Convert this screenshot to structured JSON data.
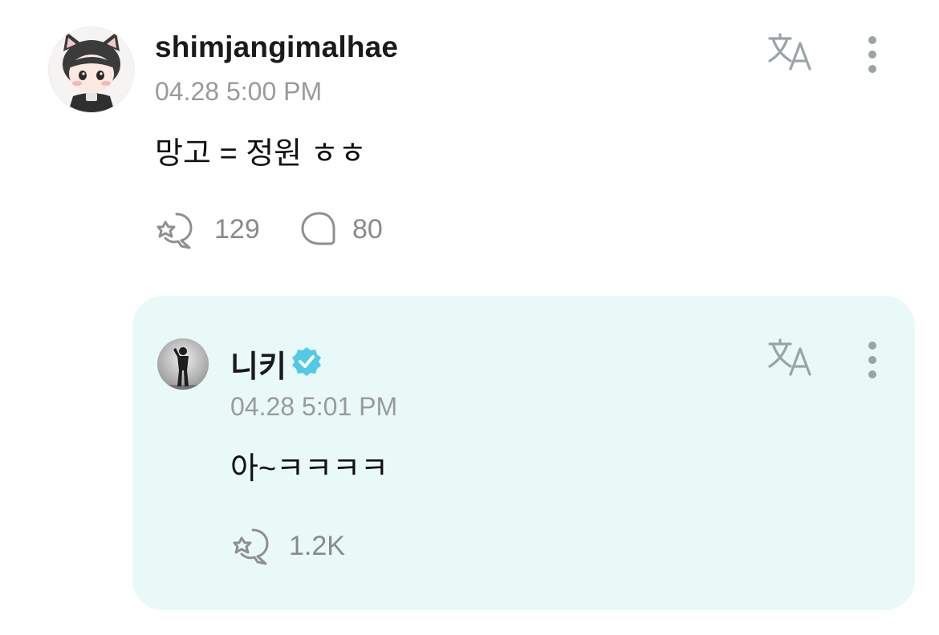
{
  "post": {
    "username": "shimjangimalhae",
    "timestamp": "04.28 5:00 PM",
    "text": "망고 = 정원 ㅎㅎ",
    "likes": "129",
    "replies": "80"
  },
  "reply": {
    "username": "니키",
    "verified": true,
    "timestamp": "04.28 5:01 PM",
    "text": "아~ㅋㅋㅋㅋ",
    "likes": "1.2K"
  },
  "icons": {
    "like": "heart-bubble-icon",
    "comment": "comment-bubble-icon",
    "translate": "translate-icon",
    "more": "more-vertical-icon",
    "verified": "verified-badge-icon"
  },
  "colors": {
    "reply_background": "#e9f9f7",
    "icon_gray": "#8f8f8f",
    "translate_gray": "#9aa3a5",
    "verified_blue": "#52c9e6"
  }
}
